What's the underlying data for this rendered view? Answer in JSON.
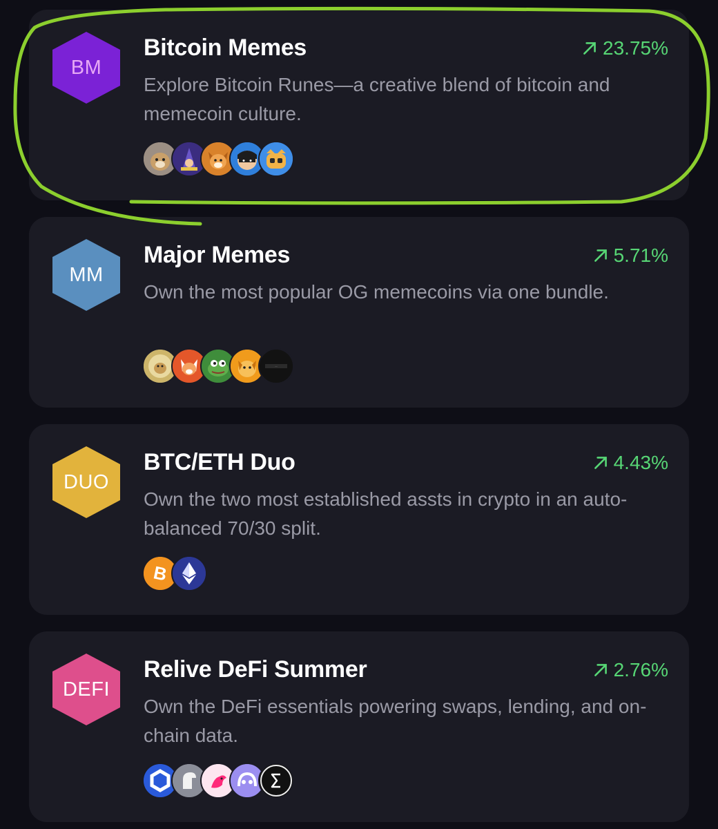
{
  "cards": [
    {
      "badge": "BM",
      "badge_bg": "#7b22d6",
      "badge_fg": "#e6a8f5",
      "title": "Bitcoin Memes",
      "change": "23.75%",
      "description": "Explore Bitcoin Runes—a creative blend of bitcoin and memecoin culture.",
      "tokens": [
        "dog-token-icon",
        "wizard-token-icon",
        "shiba-token-icon",
        "ninja-token-icon",
        "cat-token-icon"
      ]
    },
    {
      "badge": "MM",
      "badge_bg": "#5a8fbf",
      "badge_fg": "#ffffff",
      "title": "Major Memes",
      "change": "5.71%",
      "description": "Own the most popular OG memecoins via one bundle.",
      "tokens": [
        "doge-token-icon",
        "shib-token-icon",
        "pepe-token-icon",
        "bonk-token-icon",
        "floki-token-icon"
      ]
    },
    {
      "badge": "DUO",
      "badge_bg": "#e2b33c",
      "badge_fg": "#ffffff",
      "title": "BTC/ETH Duo",
      "change": "4.43%",
      "description": "Own the two most established assts in crypto in an auto-balanced 70/30 split.",
      "tokens": [
        "bitcoin-token-icon",
        "ethereum-token-icon"
      ]
    },
    {
      "badge": "DEFI",
      "badge_bg": "#de4f8c",
      "badge_fg": "#ffffff",
      "title": "Relive DeFi Summer",
      "change": "2.76%",
      "description": "Own the DeFi essentials powering swaps, lending, and on-chain data.",
      "tokens": [
        "chainlink-token-icon",
        "aave-ghost-token-icon",
        "uniswap-token-icon",
        "aave-token-icon",
        "ens-token-icon"
      ]
    }
  ],
  "colors": {
    "positive": "#57d675",
    "highlight_stroke": "#8ccf2e"
  }
}
